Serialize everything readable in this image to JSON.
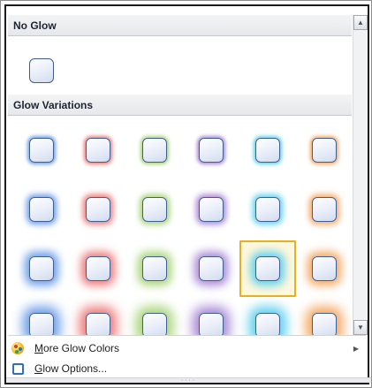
{
  "sections": {
    "no_glow_title": "No Glow",
    "variations_title": "Glow Variations"
  },
  "glow_colors": [
    {
      "name": "blue",
      "hex": "#6e9ee8"
    },
    {
      "name": "red",
      "hex": "#ec7a7a"
    },
    {
      "name": "green",
      "hex": "#a8d47a"
    },
    {
      "name": "purple",
      "hex": "#a98ad6"
    },
    {
      "name": "aqua",
      "hex": "#5fd0ef"
    },
    {
      "name": "orange",
      "hex": "#f4a865"
    }
  ],
  "glow_rows": 4,
  "selected": {
    "row": 3,
    "column": 5
  },
  "menu": {
    "more_colors": "More Glow Colors",
    "more_colors_access_key": "M",
    "options": "Glow Options...",
    "options_access_key": "G"
  },
  "scrollbar": {
    "up_icon": "scroll-up-arrow-icon",
    "down_icon": "scroll-down-arrow-icon"
  },
  "accent": {
    "selection_border": "#e8b021",
    "swatch_border": "#3f5f93"
  }
}
